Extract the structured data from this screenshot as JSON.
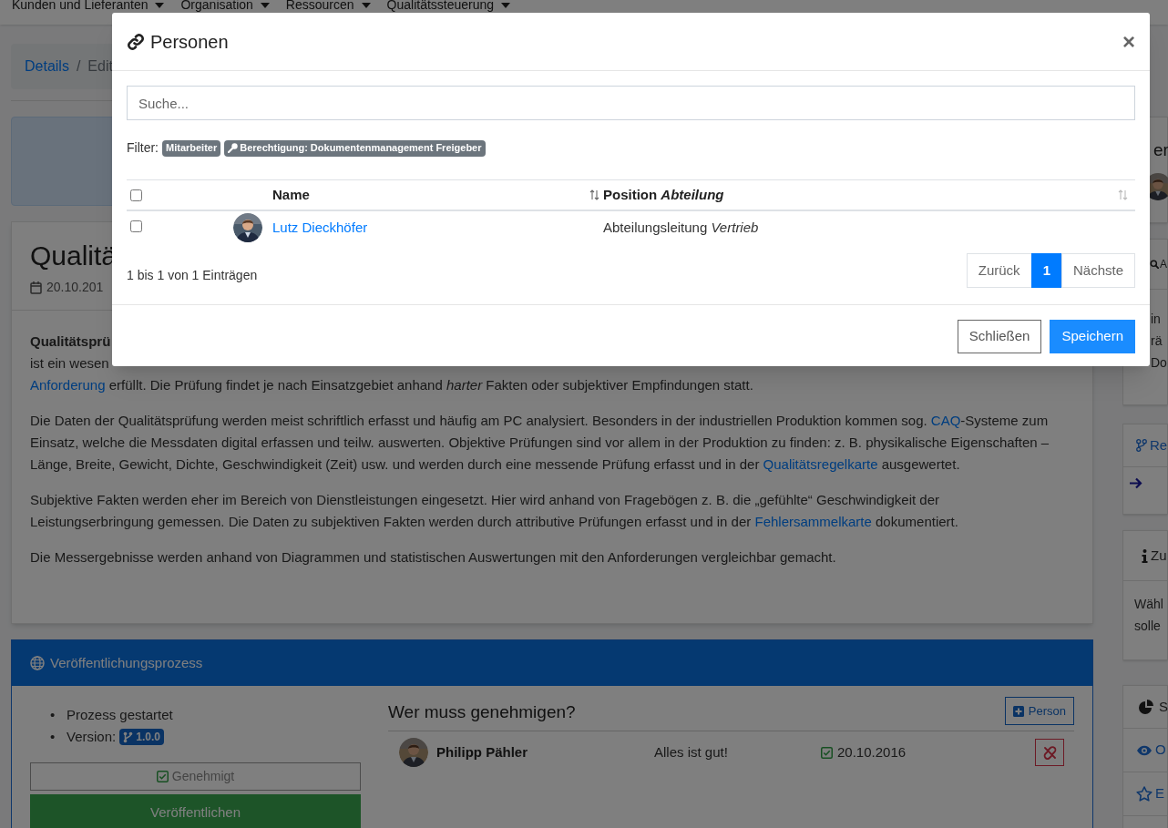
{
  "navbar": {
    "items": [
      {
        "label": "Kunden und Lieferanten"
      },
      {
        "label": "Organisation"
      },
      {
        "label": "Ressourcen"
      },
      {
        "label": "Qualitätssteuerung"
      }
    ]
  },
  "breadcrumb": {
    "items": [
      {
        "label": "Details",
        "kind": "link"
      },
      {
        "label": "Edit",
        "kind": "current"
      }
    ],
    "separator": "/"
  },
  "article": {
    "title": "Qualitä",
    "date": "20.10.201",
    "lead": "Qualitätsprü",
    "lead_continuation": "ist ein wesen",
    "paragraphs": [
      [
        {
          "kind": "link",
          "text": "Anforderung"
        },
        {
          "kind": "text",
          "text": " erfüllt. Die Prüfung findet je nach Einsatzgebiet anhand "
        },
        {
          "kind": "italic",
          "text": "harter"
        },
        {
          "kind": "text",
          "text": " Fakten oder subjektiver Empfindungen statt."
        }
      ],
      [
        {
          "kind": "text",
          "text": "Die Daten der Qualitätsprüfung werden meist schriftlich erfasst und häufig am PC analysiert. Besonders in der industriellen Produktion kommen sog. "
        },
        {
          "kind": "link",
          "text": "CAQ"
        },
        {
          "kind": "text",
          "text": "-Systeme zum Einsatz, welche die Messdaten digital erfassen und teilw. auswerten. Objektive Prüfungen sind vor allem in der Produktion zu finden: z. B. physikalische Eigenschaften – Länge, Breite, Gewicht, Dichte, Geschwindigkeit (Zeit) usw. und werden durch eine messende Prüfung erfasst und in der "
        },
        {
          "kind": "link",
          "text": "Qualitätsregelkarte"
        },
        {
          "kind": "text",
          "text": " ausgewertet."
        }
      ],
      [
        {
          "kind": "text",
          "text": "Subjektive Fakten werden eher im Bereich von Dienstleistungen eingesetzt. Hier wird anhand von Fragebögen z. B. die „gefühlte“ Geschwindigkeit der Leistungserbringung gemessen. Die Daten zu subjektiven Fakten werden durch attributive Prüfungen erfasst und in der "
        },
        {
          "kind": "link",
          "text": "Fehlersammelkarte"
        },
        {
          "kind": "text",
          "text": " dokumentiert."
        }
      ],
      [
        {
          "kind": "text",
          "text": "Die Messergebnisse werden anhand von Diagrammen und statistischen Auswertungen mit den Anforderungen vergleichbar gemacht."
        }
      ]
    ]
  },
  "process": {
    "title": "Veröffentlichungsprozess",
    "facts": [
      {
        "kind": "text",
        "bullet": "•",
        "text": "Prozess gestartet"
      },
      {
        "kind": "version",
        "bullet": "•",
        "text": "Version:",
        "badge": "1.0.0"
      }
    ],
    "approved_button": "Genehmigt",
    "publish_button": "Veröffentlichen",
    "approvers_title": "Wer muss genehmigen?",
    "add_button": "Person",
    "approvers": [
      {
        "name": "Philipp Pähler",
        "comment": "Alles ist gut!",
        "date": "20.10.2016",
        "approved": true
      }
    ]
  },
  "sidebar": {
    "cards": [
      {
        "kind": "people",
        "title": "er"
      },
      {
        "kind": "search",
        "title": "A",
        "lines": [
          "in",
          "rä",
          "Do"
        ]
      },
      {
        "kind": "branch",
        "title": "Re"
      },
      {
        "kind": "info",
        "title": "Zu",
        "lines": [
          "Wähl",
          "solle"
        ]
      },
      {
        "kind": "stats",
        "title": "S",
        "items": [
          {
            "kind": "eye",
            "label": "O"
          },
          {
            "kind": "star",
            "label": "E"
          }
        ]
      }
    ]
  },
  "modal": {
    "title": "Personen",
    "close": "×",
    "search_placeholder": "Suche...",
    "filter_label": "Filter:",
    "filters": [
      {
        "kind": "plain",
        "label": "Mitarbeiter"
      },
      {
        "kind": "permission",
        "label": "Berechtigung: Dokumentenmanagement Freigeber"
      }
    ],
    "select_all_checked": false,
    "columns": [
      {
        "label": "Name"
      },
      {
        "label": "Position *Abteilung*"
      }
    ],
    "rows": [
      {
        "checked": false,
        "name": "Lutz Dieckhöfer",
        "position": "Abteilungsleitung *Vertrieb*"
      }
    ],
    "info": "1 bis 1 von 1 Einträgen",
    "pagination": [
      {
        "label": "Zurück",
        "selected": false
      },
      {
        "label": "1",
        "selected": true
      },
      {
        "label": "Nächste",
        "selected": false
      }
    ],
    "buttons": [
      {
        "kind": "secondary",
        "label": "Schließen"
      },
      {
        "kind": "primary",
        "label": "Speichern"
      }
    ]
  }
}
